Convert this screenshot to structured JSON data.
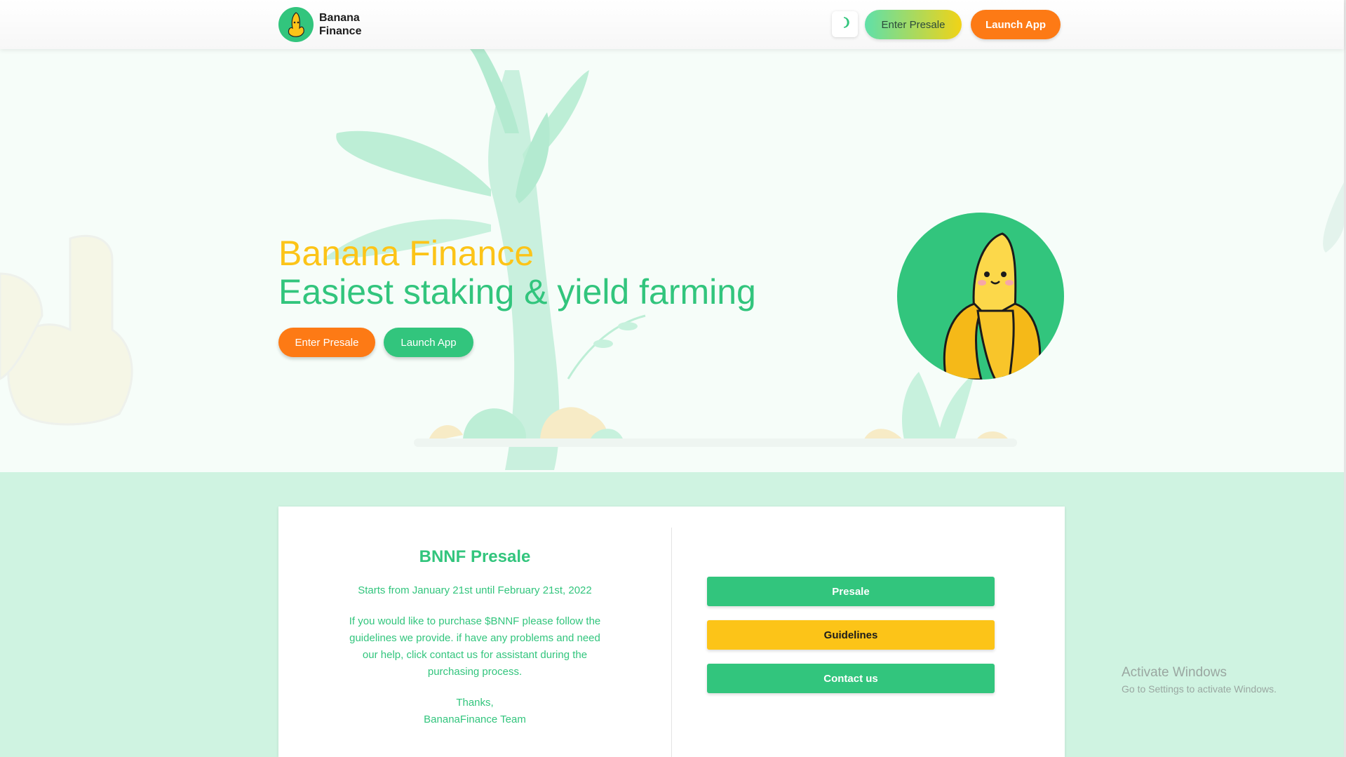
{
  "header": {
    "logo_line1": "Banana",
    "logo_line2": "Finance",
    "enter_presale": "Enter Presale",
    "launch_app": "Launch App",
    "theme_icon": "moon-icon"
  },
  "hero": {
    "title_line1": "Banana Finance",
    "title_line2": "Easiest staking & yield farming",
    "enter_presale": "Enter Presale",
    "launch_app": "Launch App"
  },
  "presale_card": {
    "title": "BNNF Presale",
    "dates": "Starts from January 21st until February 21st, 2022",
    "body": "If you would like to purchase $BNNF please follow the guidelines we provide. if have any problems and need our help, click contact us for assistant during the purchasing process.",
    "thanks": "Thanks,",
    "signature": "BananaFinance Team",
    "buttons": {
      "presale": "Presale",
      "guidelines": "Guidelines",
      "contact": "Contact us"
    }
  },
  "watermark": {
    "line1": "Activate Windows",
    "line2": "Go to Settings to activate Windows."
  },
  "colors": {
    "green": "#32c57d",
    "yellow": "#fcc418",
    "orange": "#fd7a15",
    "mint_bg": "#cff3e1"
  }
}
